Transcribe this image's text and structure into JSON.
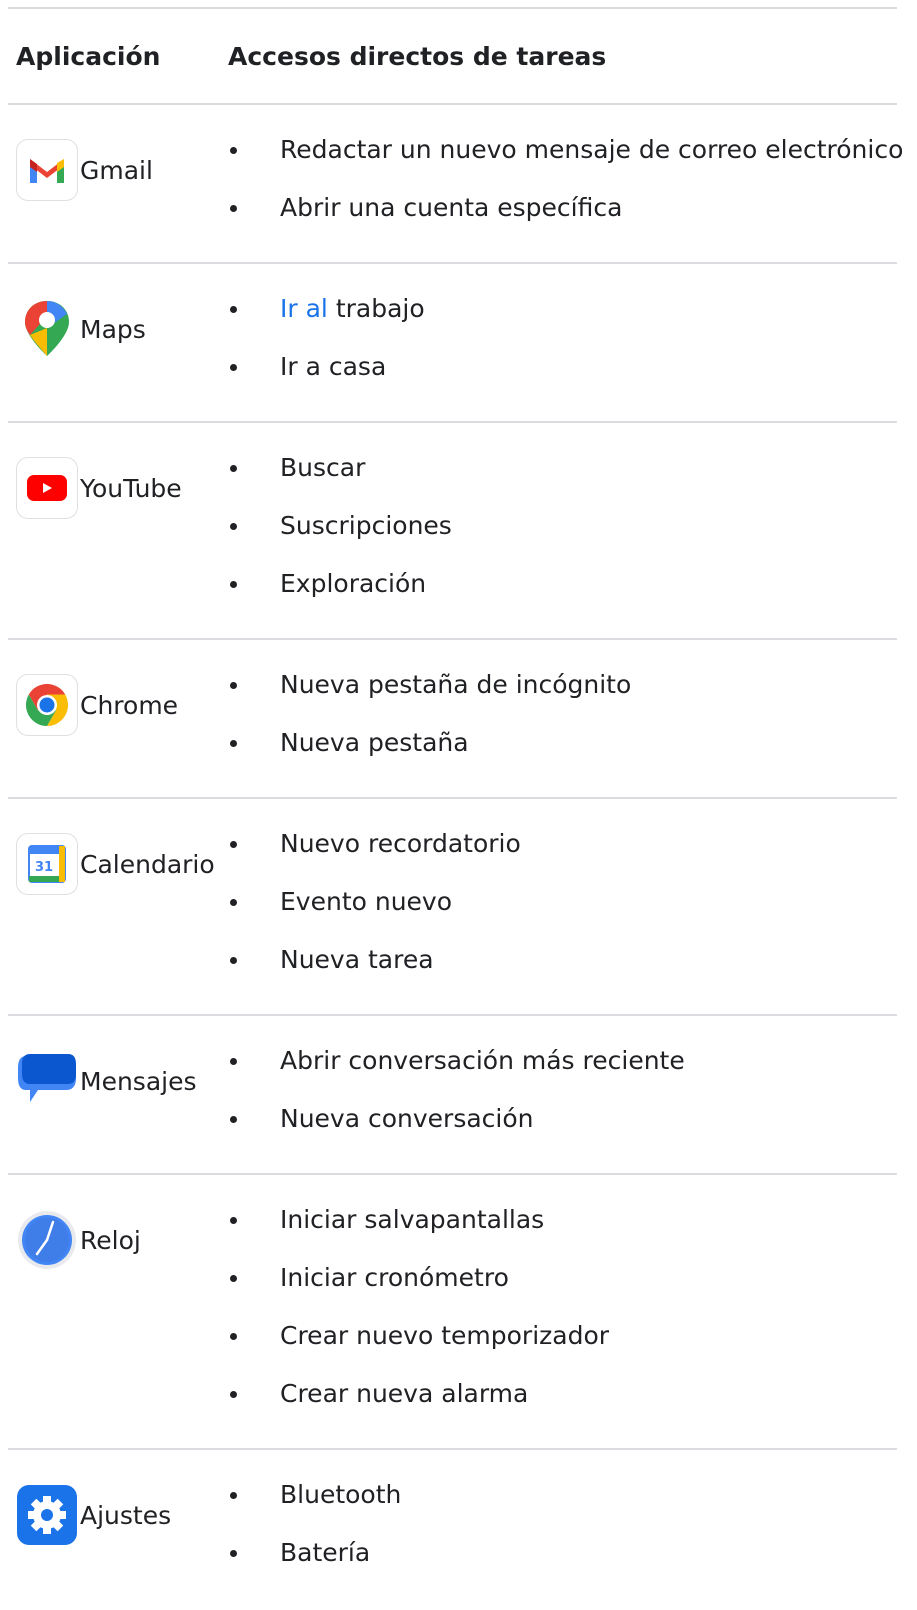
{
  "header": {
    "col_app": "Aplicación",
    "col_shortcuts": "Accesos directos de tareas"
  },
  "rows": [
    {
      "app": "Gmail",
      "icon": "gmail-icon",
      "shortcuts": [
        "Redactar un nuevo mensaje de correo electrónico",
        "Abrir una cuenta específica"
      ]
    },
    {
      "app": "Maps",
      "icon": "maps-icon",
      "shortcuts": [
        "trabajo",
        "Ir a casa"
      ],
      "link_prefix": "Ir al"
    },
    {
      "app": "YouTube",
      "icon": "youtube-icon",
      "shortcuts": [
        "Buscar",
        "Suscripciones",
        "Exploración"
      ]
    },
    {
      "app": "Chrome",
      "icon": "chrome-icon",
      "shortcuts": [
        "Nueva pestaña de incógnito",
        "Nueva pestaña"
      ]
    },
    {
      "app": "Calendario",
      "icon": "calendar-icon",
      "icon_text": "31",
      "shortcuts": [
        "Nuevo recordatorio",
        "Evento nuevo",
        "Nueva tarea"
      ]
    },
    {
      "app": "Mensajes",
      "icon": "messages-icon",
      "shortcuts": [
        "Abrir conversación más reciente",
        "Nueva conversación"
      ]
    },
    {
      "app": "Reloj",
      "icon": "clock-icon",
      "shortcuts": [
        "Iniciar salvapantallas",
        "Iniciar cronómetro",
        "Crear nuevo temporizador",
        "Crear nueva alarma"
      ]
    },
    {
      "app": "Ajustes",
      "icon": "settings-icon",
      "shortcuts": [
        "Bluetooth",
        "Batería"
      ]
    }
  ],
  "colors": {
    "link": "#1a73e8",
    "divider": "#dadce0",
    "text": "#202124"
  }
}
